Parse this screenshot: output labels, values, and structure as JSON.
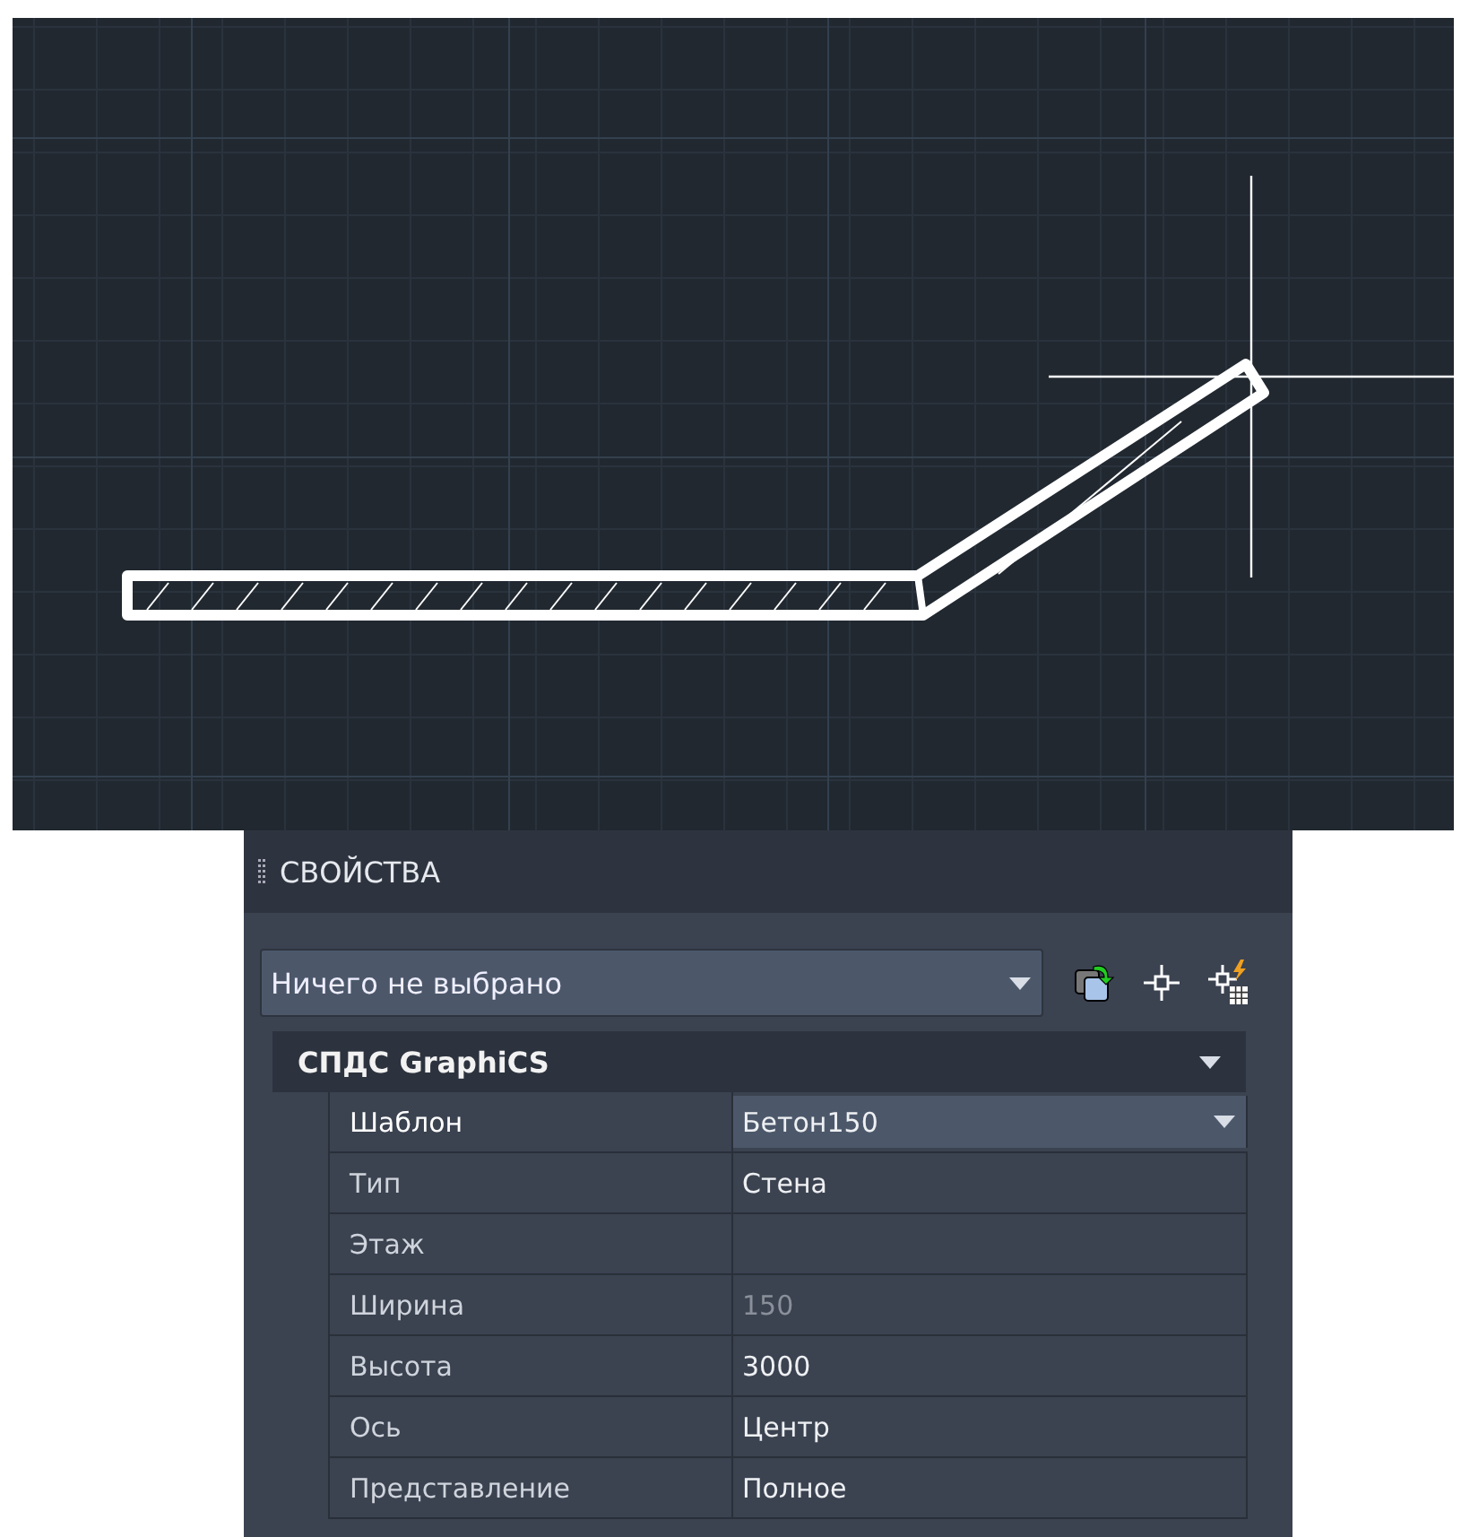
{
  "panel": {
    "title": "СВОЙСТВА",
    "selection": "Ничего не выбрано",
    "section": {
      "title": "СПДС GraphiCS",
      "expanded": true,
      "rows": [
        {
          "label": "Шаблон",
          "value": "Бетон150",
          "kind": "dropdown",
          "selected": true,
          "disabled": false
        },
        {
          "label": "Тип",
          "value": "Стена",
          "kind": "text",
          "selected": false,
          "disabled": false
        },
        {
          "label": "Этаж",
          "kind": "text",
          "selected": false,
          "disabled": false
        },
        {
          "label": "Ширина",
          "value": "150",
          "kind": "text",
          "selected": false,
          "disabled": true
        },
        {
          "label": "Высота",
          "value": "3000",
          "kind": "text",
          "selected": false,
          "disabled": false
        },
        {
          "label": "Ось",
          "value": "Центр",
          "kind": "text",
          "selected": false,
          "disabled": false
        },
        {
          "label": "Представление",
          "value": "Полное",
          "kind": "text",
          "selected": false,
          "disabled": false
        }
      ]
    }
  }
}
